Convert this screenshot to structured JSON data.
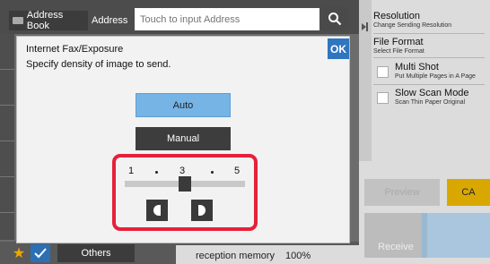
{
  "topbar": {
    "address_book_label": "Address Book",
    "address_label": "Address",
    "address_placeholder": "Touch to input Address",
    "search_icon": "search-icon"
  },
  "right_panel": {
    "items": [
      {
        "title": "Resolution",
        "sub": "Change Sending Resolution"
      },
      {
        "title": "File Format",
        "sub": "Select File Format"
      },
      {
        "title": "Multi Shot",
        "sub": "Put Multiple Pages in A Page"
      },
      {
        "title": "Slow Scan Mode",
        "sub": "Scan Thin Paper Original"
      }
    ],
    "preview_label": "Preview",
    "ca_label": "CA",
    "receive_label": "Receive",
    "ca_color": "#d9a800"
  },
  "bottom": {
    "others_label": "Others",
    "reception_label": "reception memory",
    "memory_value": "100%"
  },
  "dialog": {
    "title": "Internet Fax/Exposure",
    "description": "Specify density of image to send.",
    "ok_label": "OK",
    "auto_label": "Auto",
    "manual_label": "Manual",
    "scale": {
      "min_label": "1",
      "mid_label": "3",
      "max_label": "5",
      "min": 1,
      "max": 5,
      "value": 3
    },
    "lighter_icon": "lighter-icon",
    "darker_icon": "darker-icon",
    "highlight_color": "#e6203a",
    "auto_color": "#76b4e6"
  }
}
